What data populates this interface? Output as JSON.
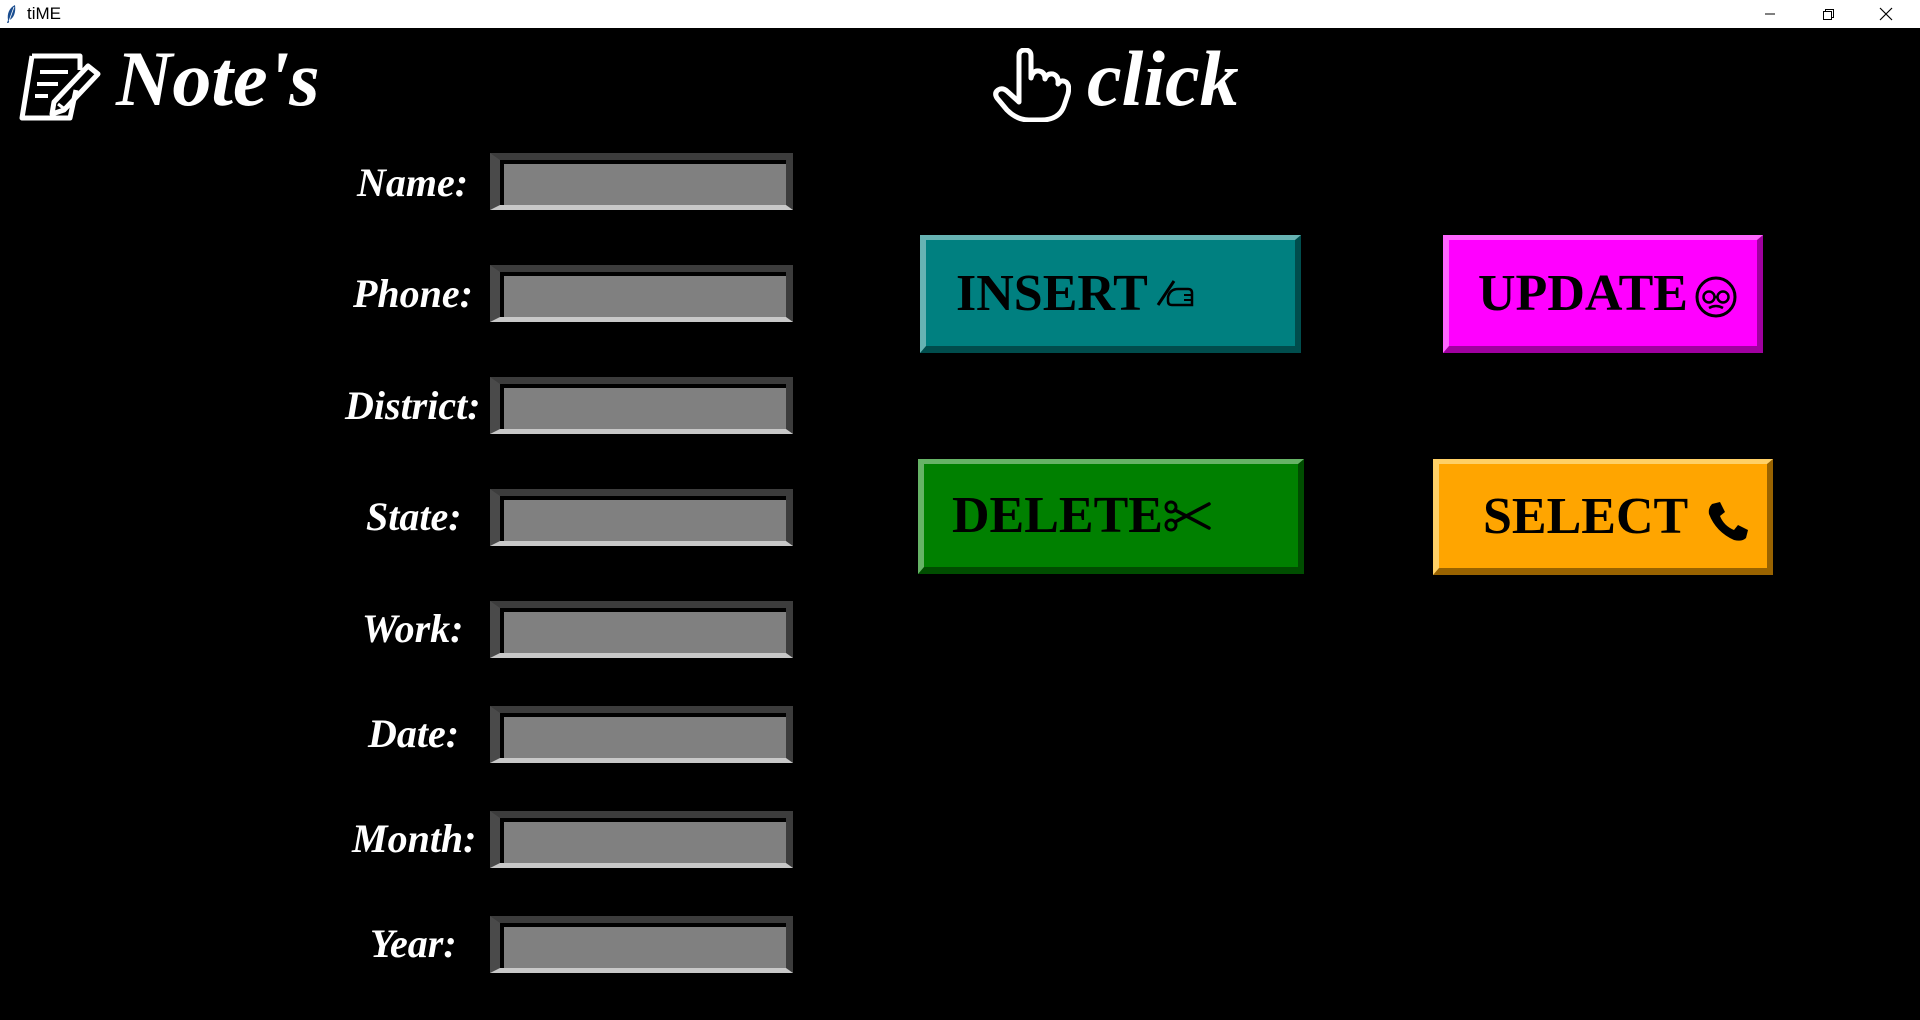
{
  "window": {
    "title": "tiME",
    "controls": {
      "minimize": "minimize-icon",
      "maximize": "restore-icon",
      "close": "close-icon"
    }
  },
  "header": {
    "notes_title": "Note's",
    "notes_icon": "notepad-pencil-icon",
    "click_title": "click",
    "click_icon": "pointing-hand-icon"
  },
  "form": {
    "fields": [
      {
        "label": "Name:",
        "value": ""
      },
      {
        "label": "Phone:",
        "value": ""
      },
      {
        "label": "District:",
        "value": ""
      },
      {
        "label": "State:",
        "value": ""
      },
      {
        "label": "Work:",
        "value": ""
      },
      {
        "label": "Date:",
        "value": ""
      },
      {
        "label": "Month:",
        "value": ""
      },
      {
        "label": "Year:",
        "value": ""
      }
    ]
  },
  "buttons": {
    "insert": {
      "label": "INSERT",
      "icon": "writing-hand-icon",
      "color": "#008080"
    },
    "update": {
      "label": "UPDATE",
      "icon": "smiley-glasses-icon",
      "color": "#ff00ff"
    },
    "delete": {
      "label": "DELETE",
      "icon": "scissors-icon",
      "color": "#008000"
    },
    "select": {
      "label": "SELECT",
      "icon": "telephone-icon",
      "color": "#ffa500"
    }
  },
  "colors": {
    "background": "#000000",
    "text": "#ffffff",
    "entry_bg": "#808080"
  }
}
